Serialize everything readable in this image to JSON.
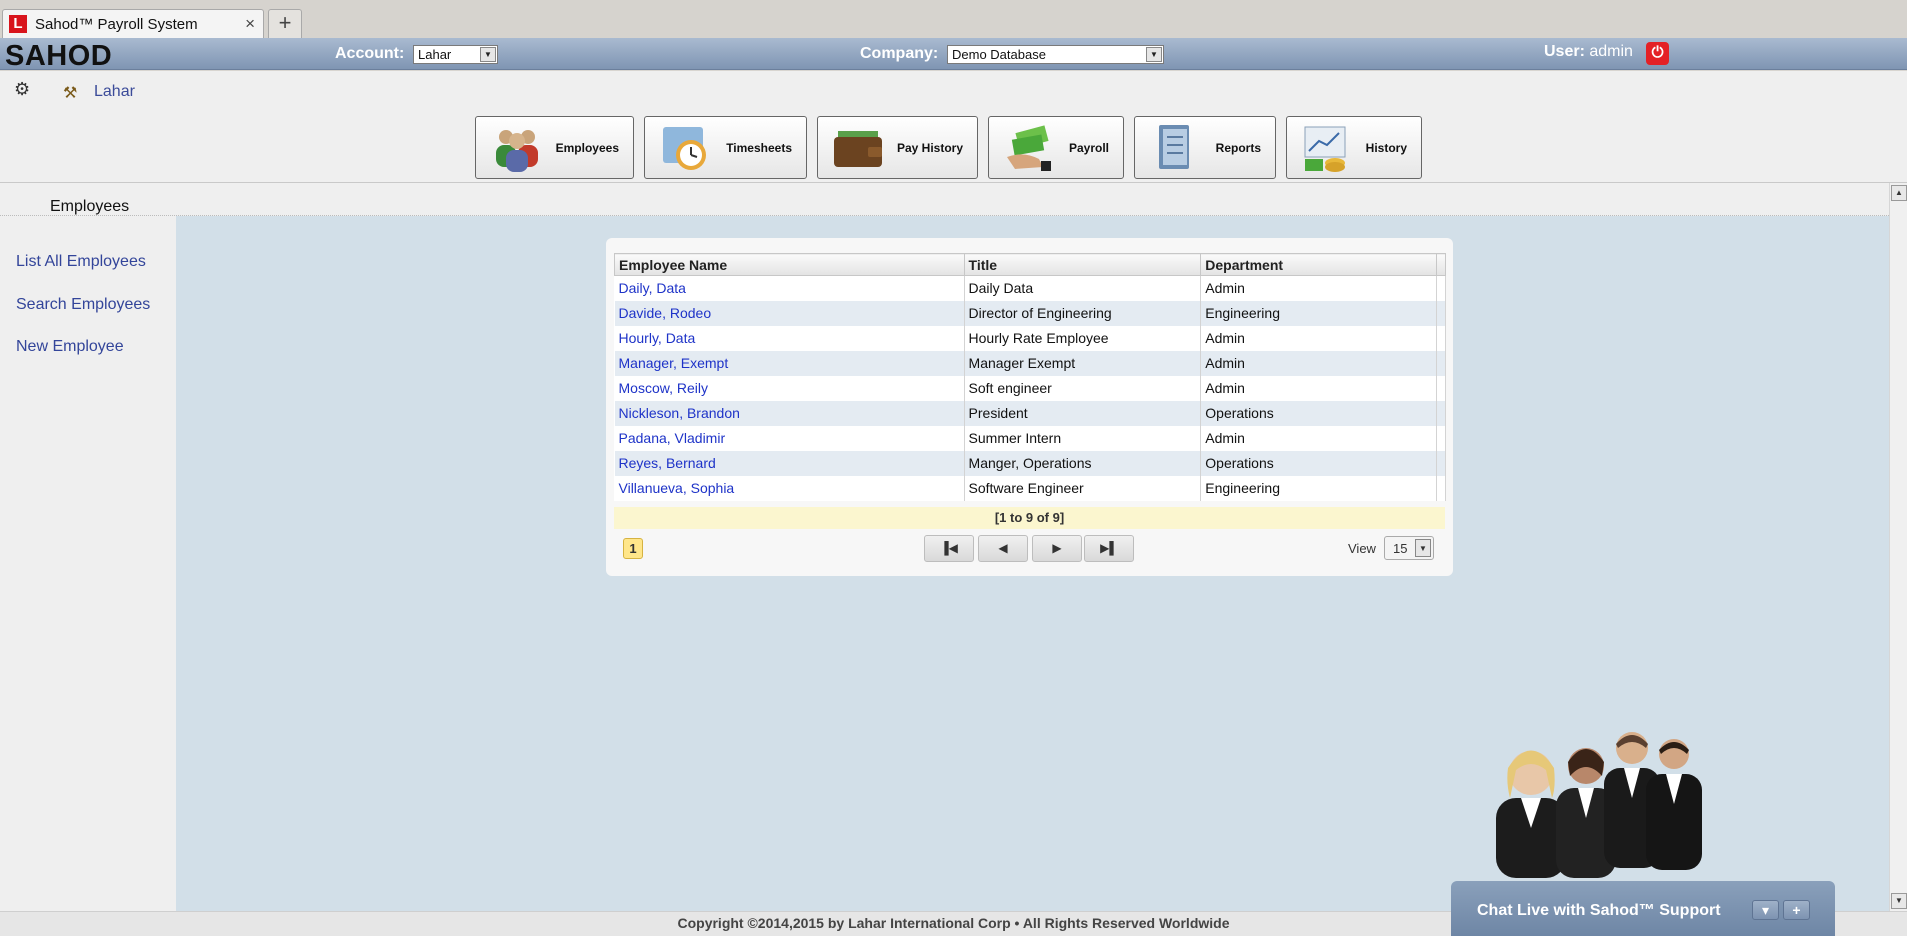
{
  "browser": {
    "tab_title": "Sahod™ Payroll System",
    "tab_logo": "L",
    "close_icon": "×",
    "newtab_icon": "+"
  },
  "header": {
    "logo": "SAHOD",
    "account_label": "Account:",
    "account_value": "Lahar",
    "company_label": "Company:",
    "company_value": "Demo Database",
    "user_label": "User:",
    "user_value": "admin"
  },
  "breadcrumb": {
    "label": "Lahar"
  },
  "toolbar": [
    {
      "label": "Employees"
    },
    {
      "label": "Timesheets"
    },
    {
      "label": "Pay History"
    },
    {
      "label": "Payroll"
    },
    {
      "label": "Reports"
    },
    {
      "label": "History"
    }
  ],
  "section_title": "Employees",
  "sidebar": [
    {
      "label": "List All Employees"
    },
    {
      "label": "Search Employees"
    },
    {
      "label": "New Employee"
    }
  ],
  "grid": {
    "columns": [
      "Employee Name",
      "Title",
      "Department"
    ],
    "rows": [
      {
        "name": "Daily, Data",
        "title": "Daily Data",
        "department": "Admin"
      },
      {
        "name": "Davide, Rodeo",
        "title": "Director of Engineering",
        "department": "Engineering"
      },
      {
        "name": "Hourly, Data",
        "title": "Hourly Rate Employee",
        "department": "Admin"
      },
      {
        "name": "Manager, Exempt",
        "title": "Manager Exempt",
        "department": "Admin"
      },
      {
        "name": "Moscow, Reily",
        "title": "Soft engineer",
        "department": "Admin"
      },
      {
        "name": "Nickleson, Brandon",
        "title": "President",
        "department": "Operations"
      },
      {
        "name": "Padana, Vladimir",
        "title": "Summer Intern",
        "department": "Admin"
      },
      {
        "name": "Reyes, Bernard",
        "title": "Manger, Operations",
        "department": "Operations"
      },
      {
        "name": "Villanueva, Sophia",
        "title": "Software Engineer",
        "department": "Engineering"
      }
    ],
    "range_text": "[1 to 9 of 9]",
    "current_page": "1",
    "view_label": "View",
    "view_value": "15"
  },
  "footer": {
    "copyright": "Copyright ©2014,2015 by Lahar International Corp • All Rights Reserved Worldwide"
  },
  "chat": {
    "label": "Chat Live with Sahod™ Support"
  },
  "colors": {
    "accent": "#7f95b3",
    "link": "#1e33c8",
    "power": "#e42126"
  }
}
